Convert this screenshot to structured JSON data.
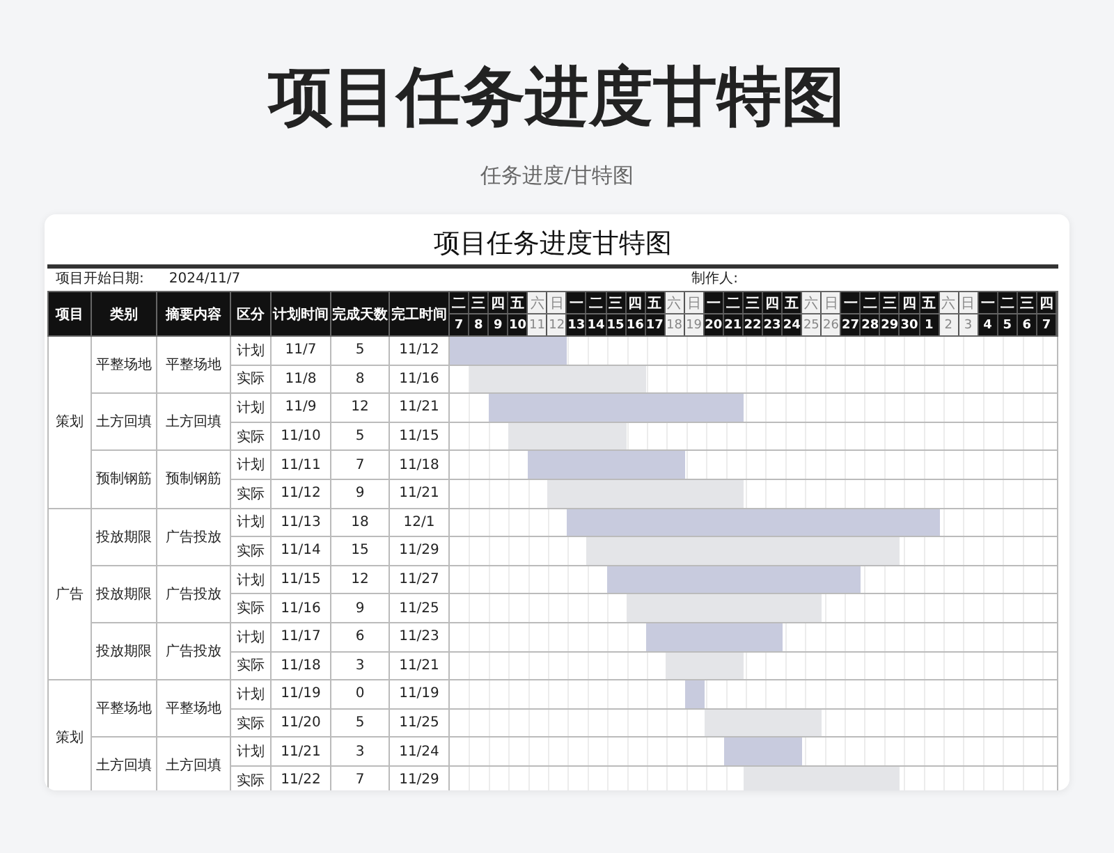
{
  "page": {
    "title": "项目任务进度甘特图",
    "subtitle": "任务进度/甘特图"
  },
  "sheet": {
    "title": "项目任务进度甘特图",
    "start_label": "项目开始日期:",
    "start_date": "2024/11/7",
    "author_label": "制作人:",
    "columns": [
      "项目",
      "类别",
      "摘要内容",
      "区分",
      "计划时间",
      "完成天数",
      "完工时间"
    ],
    "days": [
      {
        "weekday": "二",
        "date": "7",
        "weekend": false
      },
      {
        "weekday": "三",
        "date": "8",
        "weekend": false
      },
      {
        "weekday": "四",
        "date": "9",
        "weekend": false
      },
      {
        "weekday": "五",
        "date": "10",
        "weekend": false
      },
      {
        "weekday": "六",
        "date": "11",
        "weekend": true
      },
      {
        "weekday": "日",
        "date": "12",
        "weekend": true
      },
      {
        "weekday": "一",
        "date": "13",
        "weekend": false
      },
      {
        "weekday": "二",
        "date": "14",
        "weekend": false
      },
      {
        "weekday": "三",
        "date": "15",
        "weekend": false
      },
      {
        "weekday": "四",
        "date": "16",
        "weekend": false
      },
      {
        "weekday": "五",
        "date": "17",
        "weekend": false
      },
      {
        "weekday": "六",
        "date": "18",
        "weekend": true
      },
      {
        "weekday": "日",
        "date": "19",
        "weekend": true
      },
      {
        "weekday": "一",
        "date": "20",
        "weekend": false
      },
      {
        "weekday": "二",
        "date": "21",
        "weekend": false
      },
      {
        "weekday": "三",
        "date": "22",
        "weekend": false
      },
      {
        "weekday": "四",
        "date": "23",
        "weekend": false
      },
      {
        "weekday": "五",
        "date": "24",
        "weekend": false
      },
      {
        "weekday": "六",
        "date": "25",
        "weekend": true
      },
      {
        "weekday": "日",
        "date": "26",
        "weekend": true
      },
      {
        "weekday": "一",
        "date": "27",
        "weekend": false
      },
      {
        "weekday": "二",
        "date": "28",
        "weekend": false
      },
      {
        "weekday": "三",
        "date": "29",
        "weekend": false
      },
      {
        "weekday": "四",
        "date": "30",
        "weekend": false
      },
      {
        "weekday": "五",
        "date": "1",
        "weekend": false
      },
      {
        "weekday": "六",
        "date": "2",
        "weekend": true
      },
      {
        "weekday": "日",
        "date": "3",
        "weekend": true
      },
      {
        "weekday": "一",
        "date": "4",
        "weekend": false
      },
      {
        "weekday": "二",
        "date": "5",
        "weekend": false
      },
      {
        "weekday": "三",
        "date": "6",
        "weekend": false
      },
      {
        "weekday": "四",
        "date": "7",
        "weekend": false
      }
    ],
    "groups": [
      {
        "project": "策划",
        "tasks": [
          {
            "category": "平整场地",
            "summary": "平整场地",
            "rows": [
              {
                "kind": "plan",
                "label": "计划",
                "start": "11/7",
                "days": "5",
                "end": "11/12"
              },
              {
                "kind": "actual",
                "label": "实际",
                "start": "11/8",
                "days": "8",
                "end": "11/16"
              }
            ]
          },
          {
            "category": "土方回填",
            "summary": "土方回填",
            "rows": [
              {
                "kind": "plan",
                "label": "计划",
                "start": "11/9",
                "days": "12",
                "end": "11/21"
              },
              {
                "kind": "actual",
                "label": "实际",
                "start": "11/10",
                "days": "5",
                "end": "11/15"
              }
            ]
          },
          {
            "category": "预制钢筋",
            "summary": "预制钢筋",
            "rows": [
              {
                "kind": "plan",
                "label": "计划",
                "start": "11/11",
                "days": "7",
                "end": "11/18"
              },
              {
                "kind": "actual",
                "label": "实际",
                "start": "11/12",
                "days": "9",
                "end": "11/21"
              }
            ]
          }
        ]
      },
      {
        "project": "广告",
        "tasks": [
          {
            "category": "投放期限",
            "summary": "广告投放",
            "rows": [
              {
                "kind": "plan",
                "label": "计划",
                "start": "11/13",
                "days": "18",
                "end": "12/1"
              },
              {
                "kind": "actual",
                "label": "实际",
                "start": "11/14",
                "days": "15",
                "end": "11/29"
              }
            ]
          },
          {
            "category": "投放期限",
            "summary": "广告投放",
            "rows": [
              {
                "kind": "plan",
                "label": "计划",
                "start": "11/15",
                "days": "12",
                "end": "11/27"
              },
              {
                "kind": "actual",
                "label": "实际",
                "start": "11/16",
                "days": "9",
                "end": "11/25"
              }
            ]
          },
          {
            "category": "投放期限",
            "summary": "广告投放",
            "rows": [
              {
                "kind": "plan",
                "label": "计划",
                "start": "11/17",
                "days": "6",
                "end": "11/23"
              },
              {
                "kind": "actual",
                "label": "实际",
                "start": "11/18",
                "days": "3",
                "end": "11/21"
              }
            ]
          }
        ]
      },
      {
        "project": "策划",
        "tasks": [
          {
            "category": "平整场地",
            "summary": "平整场地",
            "rows": [
              {
                "kind": "plan",
                "label": "计划",
                "start": "11/19",
                "days": "0",
                "end": "11/19"
              },
              {
                "kind": "actual",
                "label": "实际",
                "start": "11/20",
                "days": "5",
                "end": "11/25"
              }
            ]
          },
          {
            "category": "土方回填",
            "summary": "土方回填",
            "rows": [
              {
                "kind": "plan",
                "label": "计划",
                "start": "11/21",
                "days": "3",
                "end": "11/24"
              },
              {
                "kind": "actual",
                "label": "实际",
                "start": "11/22",
                "days": "7",
                "end": "11/29"
              }
            ]
          }
        ]
      }
    ]
  }
}
